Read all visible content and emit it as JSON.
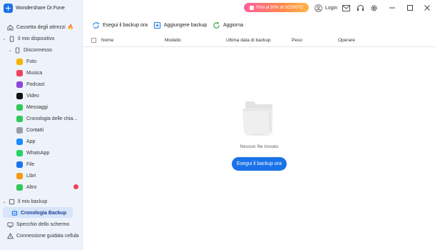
{
  "app": {
    "name": "Wondershare Dr.Fone"
  },
  "titlebar": {
    "promo": "Fino al 50% di SCONTO",
    "login": "Login"
  },
  "sidebar": {
    "toolbox": "Cassetta degli attrezzi",
    "my_device": "Il mio dispositivo",
    "disconnected": "Disconnesso",
    "apps": [
      {
        "label": "Foto",
        "color": "#f4b400",
        "icon": "photos-icon"
      },
      {
        "label": "Musica",
        "color": "#f0425c",
        "icon": "music-icon"
      },
      {
        "label": "Podcast",
        "color": "#8e44d6",
        "icon": "podcast-icon"
      },
      {
        "label": "Video",
        "color": "#111111",
        "icon": "tv-icon"
      },
      {
        "label": "Messaggi",
        "color": "#34c759",
        "icon": "messages-icon"
      },
      {
        "label": "Cronologia delle chia...",
        "color": "#34c759",
        "icon": "phone-icon"
      },
      {
        "label": "Contatti",
        "color": "#9aa0a6",
        "icon": "contacts-icon"
      },
      {
        "label": "App",
        "color": "#1a8cff",
        "icon": "appstore-icon"
      },
      {
        "label": "WhatsApp",
        "color": "#25d366",
        "icon": "whatsapp-icon"
      },
      {
        "label": "File",
        "color": "#1a73e8",
        "icon": "files-icon"
      },
      {
        "label": "Libri",
        "color": "#f39c12",
        "icon": "books-icon"
      },
      {
        "label": "Altro",
        "color": "#34c759",
        "icon": "more-icon"
      }
    ],
    "my_backup": "Il mio backup",
    "backup_history": "Cronologia Backup",
    "screen_mirror": "Specchio dello schermo",
    "guided_connection": "Connessione guidata cellula"
  },
  "toolbar": {
    "backup_now": "Esegui il backup ora",
    "add_backup": "Aggiungere backup",
    "refresh": "Aggiorna"
  },
  "table": {
    "headers": [
      "Nome",
      "Modello",
      "Ultima data di backup",
      "Peso",
      "Operare"
    ]
  },
  "empty_state": {
    "message": "Nessun file trovato",
    "button": "Esegui il backup ora"
  },
  "colors": {
    "accent": "#1a73e8",
    "sidebar_bg": "#eef3fb",
    "active_bg": "#d7e5fb"
  }
}
